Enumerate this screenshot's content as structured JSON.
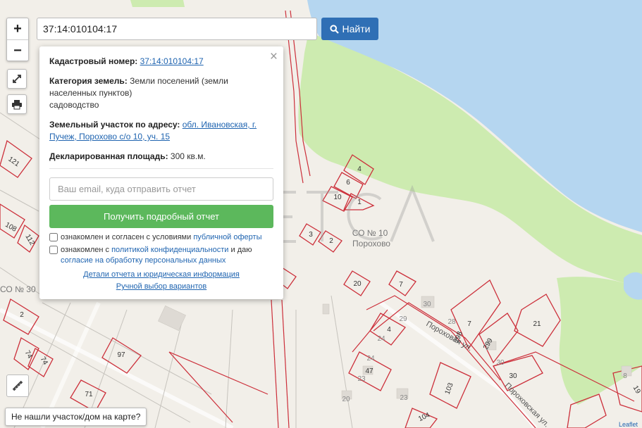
{
  "map": {
    "colors": {
      "water": "#b5d6f0",
      "green": "#cdebb0",
      "land": "#f2efe9",
      "parcel": "#cc2f3a",
      "accent": "#2f6fb5",
      "button_green": "#5cb85c"
    },
    "parcels": [
      "121",
      "108",
      "112",
      "2",
      "74",
      "74",
      "97",
      "71",
      "4",
      "6",
      "10",
      "1",
      "3",
      "2",
      "20",
      "7",
      "4",
      "47",
      "103",
      "30",
      "298",
      "299",
      "7",
      "21",
      "30",
      "104",
      "19",
      "24",
      "23",
      "23",
      "20",
      "8",
      "28",
      "30",
      "29",
      "24"
    ],
    "labels": {
      "co_10": "СО № 10",
      "porokhovo": "Порохово",
      "co_30": "СО № 30",
      "street1": "Пороховая ул.",
      "street2": "Пороховская ул.",
      "attribution": "Leaflet"
    }
  },
  "controls": {
    "zoom_in": "+",
    "zoom_out": "−",
    "fullscreen_icon": "expand-arrows-icon",
    "print_icon": "printer-icon",
    "ruler_icon": "ruler-icon"
  },
  "search": {
    "value": "37:14:010104:17",
    "button_label": "Найти",
    "button_icon": "search-icon"
  },
  "popup": {
    "cadastral_label": "Кадастровый номер:",
    "cadastral_value": "37:14:010104:17",
    "category_label": "Категория земель:",
    "category_value": "Земли поселений (земли населенных пунктов)",
    "category_extra": "садоводство",
    "address_label": "Земельный участок по адресу:",
    "address_value": "обл. Ивановская, г. Пучеж, Порохово с/о 10, уч. 15",
    "area_label": "Декларированная площадь:",
    "area_value": "300 кв.м.",
    "email_placeholder": "Ваш email, куда отправить отчет",
    "report_button": "Получить подробный отчет",
    "consent1_text": "ознакомлен и согласен с условиями ",
    "consent1_link": "публичной оферты",
    "consent2_text": "ознакомлен с ",
    "consent2_link": "политикой конфиденциальности",
    "consent2_mid": " и даю ",
    "consent2_link2": "согласие на обработку персональных данных",
    "details_link": "Детали отчета и юридическая информация",
    "manual_link": "Ручной выбор вариантов",
    "close": "×"
  },
  "not_found": "Не нашли участок/дом на карте?"
}
